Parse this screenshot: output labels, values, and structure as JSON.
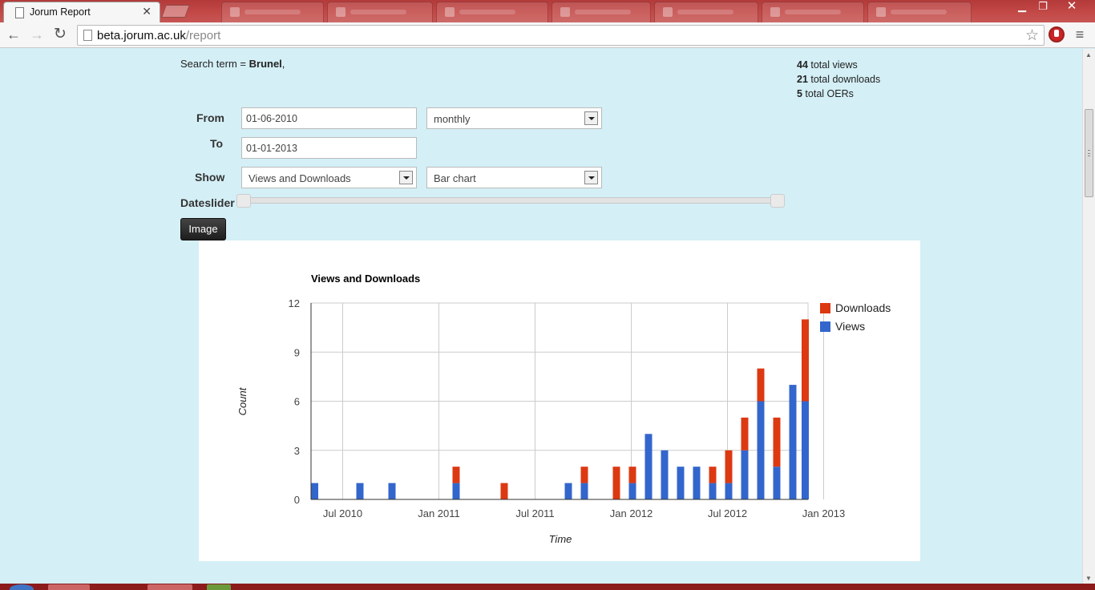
{
  "browser": {
    "tab_title": "Jorum Report",
    "url_host": "beta.jorum.ac.uk",
    "url_path": "/report"
  },
  "report": {
    "search_label": "Search term = ",
    "search_term": "Brunel",
    "search_suffix": ",",
    "totals": {
      "views_count": "44",
      "views_label": " total views",
      "downloads_count": "21",
      "downloads_label": " total downloads",
      "oers_count": "5",
      "oers_label": " total OERs"
    },
    "form": {
      "from_label": "From",
      "from_value": "01-06-2010",
      "to_label": "To",
      "to_value": "01-01-2013",
      "interval_value": "monthly",
      "show_label": "Show",
      "show_value": "Views and Downloads",
      "chart_type_value": "Bar chart",
      "dateslider_label": "Dateslider",
      "image_button": "Image"
    }
  },
  "chart_data": {
    "type": "bar",
    "stacked": true,
    "title": "Views and Downloads",
    "xlabel": "Time",
    "ylabel": "Count",
    "ylim": [
      0,
      12
    ],
    "yticks": [
      0,
      3,
      6,
      9,
      12
    ],
    "xticks": [
      "Jul 2010",
      "Jan 2011",
      "Jul 2011",
      "Jan 2012",
      "Jul 2012",
      "Jan 2013"
    ],
    "categories": [
      "Jun 2010",
      "Jul 2010",
      "Aug 2010",
      "Sep 2010",
      "Oct 2010",
      "Nov 2010",
      "Dec 2010",
      "Jan 2011",
      "Feb 2011",
      "Mar 2011",
      "Apr 2011",
      "May 2011",
      "Jun 2011",
      "Jul 2011",
      "Aug 2011",
      "Sep 2011",
      "Oct 2011",
      "Nov 2011",
      "Dec 2011",
      "Jan 2012",
      "Feb 2012",
      "Mar 2012",
      "Apr 2012",
      "May 2012",
      "Jun 2012",
      "Jul 2012",
      "Aug 2012",
      "Sep 2012",
      "Oct 2012",
      "Nov 2012",
      "Dec 2012",
      "Jan 2013"
    ],
    "series": [
      {
        "name": "Views",
        "color": "#3366cc",
        "values": [
          1,
          0,
          0,
          1,
          0,
          1,
          0,
          0,
          0,
          1,
          0,
          0,
          0,
          0,
          0,
          0,
          1,
          1,
          0,
          0,
          1,
          4,
          3,
          2,
          2,
          1,
          1,
          3,
          6,
          2,
          7,
          6
        ]
      },
      {
        "name": "Downloads",
        "color": "#dc3912",
        "values": [
          0,
          0,
          0,
          0,
          0,
          0,
          0,
          0,
          0,
          1,
          0,
          0,
          1,
          0,
          0,
          0,
          0,
          1,
          0,
          2,
          1,
          0,
          0,
          0,
          0,
          1,
          2,
          2,
          2,
          3,
          0,
          5
        ]
      }
    ],
    "legend_position": "right",
    "grid": true
  }
}
